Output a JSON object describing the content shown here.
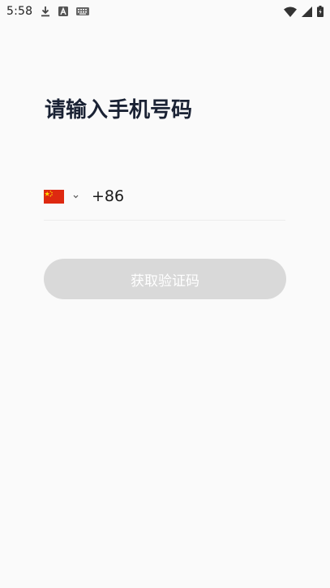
{
  "status_bar": {
    "time": "5:58",
    "icons": [
      "download-icon",
      "font-a-icon",
      "keyboard-icon",
      "wifi-icon",
      "signal-icon",
      "battery-icon"
    ]
  },
  "login": {
    "title": "请输入手机号码",
    "country": {
      "flag": "china-flag",
      "dial_code": "+86"
    },
    "phone_input": {
      "value": "",
      "placeholder": ""
    },
    "submit_label": "获取验证码"
  },
  "colors": {
    "background": "#fafafa",
    "title": "#1a2234",
    "button_disabled": "#d9d9d9",
    "button_text": "#ffffff",
    "flag_red": "#de2910",
    "flag_yellow": "#ffde00"
  }
}
